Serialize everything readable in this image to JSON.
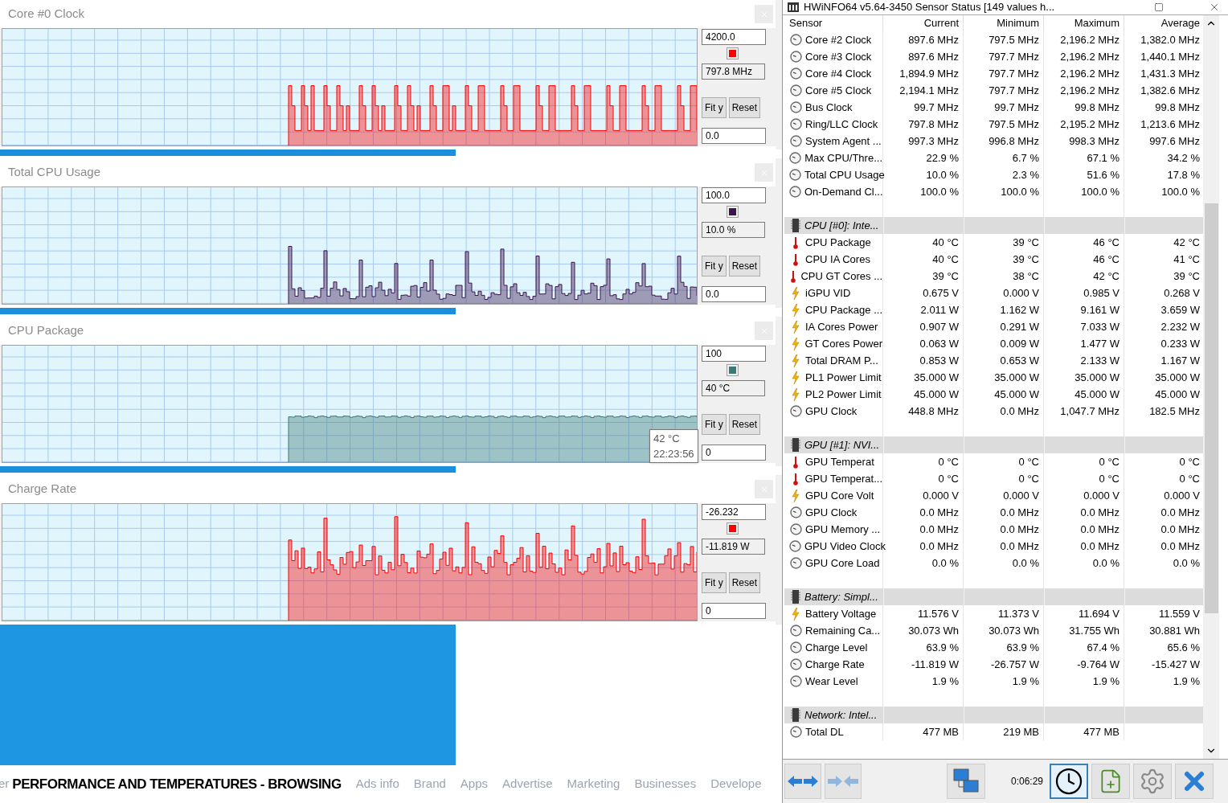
{
  "graphs": [
    {
      "title": "Core #0 Clock",
      "kind": "spiky",
      "color": "#ff0000",
      "max": "4200.0",
      "current": "797.8 MHz",
      "min": "0.0",
      "buttons": [
        "Fit y",
        "Reset"
      ]
    },
    {
      "title": "Total CPU Usage",
      "kind": "noisy",
      "color": "#3c1450",
      "max": "100.0",
      "current": "10.0 %",
      "min": "0.0",
      "buttons": [
        "Fit y",
        "Reset"
      ]
    },
    {
      "title": "CPU Package",
      "kind": "flat",
      "color": "#3c7878",
      "max": "100",
      "current": "40 °C",
      "min": "0",
      "buttons": [
        "Fit y",
        "Reset"
      ],
      "tooltip": {
        "value": "42 °C",
        "time": "22:23:56"
      }
    },
    {
      "title": "Charge Rate",
      "kind": "busy",
      "color": "#ff0000",
      "max": "-26.232",
      "current": "-11.819 W",
      "min": "0",
      "buttons": [
        "Fit y",
        "Reset"
      ]
    }
  ],
  "footer": {
    "edge_text": "er",
    "headline": "PERFORMANCE AND TEMPERATURES - BROWSING",
    "links": [
      "Ads info",
      "Brand",
      "Apps",
      "Advertise",
      "Marketing",
      "Businesses",
      "Develope"
    ]
  },
  "sensor_window": {
    "title": "HWiNFO64 v5.64-3450 Sensor Status [149 values h...",
    "columns": [
      "Sensor",
      "Current",
      "Minimum",
      "Maximum",
      "Average"
    ],
    "rows": [
      {
        "kind": "clock",
        "cells": [
          "Core #2 Clock",
          "897.6 MHz",
          "797.5 MHz",
          "2,196.2 MHz",
          "1,382.0 MHz"
        ]
      },
      {
        "kind": "clock",
        "cells": [
          "Core #3 Clock",
          "897.6 MHz",
          "797.7 MHz",
          "2,196.2 MHz",
          "1,440.1 MHz"
        ]
      },
      {
        "kind": "clock",
        "cells": [
          "Core #4 Clock",
          "1,894.9 MHz",
          "797.7 MHz",
          "2,196.2 MHz",
          "1,431.3 MHz"
        ]
      },
      {
        "kind": "clock",
        "cells": [
          "Core #5 Clock",
          "2,194.1 MHz",
          "797.7 MHz",
          "2,196.2 MHz",
          "1,382.6 MHz"
        ]
      },
      {
        "kind": "clock",
        "cells": [
          "Bus Clock",
          "99.7 MHz",
          "99.7 MHz",
          "99.8 MHz",
          "99.8 MHz"
        ]
      },
      {
        "kind": "clock",
        "cells": [
          "Ring/LLC Clock",
          "797.8 MHz",
          "797.5 MHz",
          "2,195.2 MHz",
          "1,213.6 MHz"
        ]
      },
      {
        "kind": "clock",
        "cells": [
          "System Agent ...",
          "997.3 MHz",
          "996.8 MHz",
          "998.3 MHz",
          "997.6 MHz"
        ]
      },
      {
        "kind": "clock",
        "cells": [
          "Max CPU/Thre...",
          "22.9 %",
          "6.7 %",
          "67.1 %",
          "34.2 %"
        ]
      },
      {
        "kind": "clock",
        "cells": [
          "Total CPU Usage",
          "10.0 %",
          "2.3 %",
          "51.6 %",
          "17.8 %"
        ]
      },
      {
        "kind": "clock",
        "cells": [
          "On-Demand Cl...",
          "100.0 %",
          "100.0 %",
          "100.0 %",
          "100.0 %"
        ]
      },
      {
        "kind": "blank"
      },
      {
        "kind": "group",
        "cells": [
          "CPU [#0]: Inte..."
        ]
      },
      {
        "kind": "temperature",
        "cells": [
          "CPU Package",
          "40 °C",
          "39 °C",
          "46 °C",
          "42 °C"
        ]
      },
      {
        "kind": "temperature",
        "cells": [
          "CPU IA Cores",
          "40 °C",
          "39 °C",
          "46 °C",
          "41 °C"
        ]
      },
      {
        "kind": "temperature",
        "cells": [
          "CPU GT Cores ...",
          "39 °C",
          "38 °C",
          "42 °C",
          "39 °C"
        ]
      },
      {
        "kind": "power",
        "cells": [
          "iGPU VID",
          "0.675 V",
          "0.000 V",
          "0.985 V",
          "0.268 V"
        ]
      },
      {
        "kind": "power",
        "cells": [
          "CPU Package ...",
          "2.011 W",
          "1.162 W",
          "9.161 W",
          "3.659 W"
        ]
      },
      {
        "kind": "power",
        "cells": [
          "IA Cores Power",
          "0.907 W",
          "0.291 W",
          "7.033 W",
          "2.232 W"
        ]
      },
      {
        "kind": "power",
        "cells": [
          "GT Cores Power",
          "0.063 W",
          "0.009 W",
          "1.477 W",
          "0.233 W"
        ]
      },
      {
        "kind": "power",
        "cells": [
          "Total DRAM P...",
          "0.853 W",
          "0.653 W",
          "2.133 W",
          "1.167 W"
        ]
      },
      {
        "kind": "power",
        "cells": [
          "PL1 Power Limit",
          "35.000 W",
          "35.000 W",
          "35.000 W",
          "35.000 W"
        ]
      },
      {
        "kind": "power",
        "cells": [
          "PL2 Power Limit",
          "45.000 W",
          "45.000 W",
          "45.000 W",
          "45.000 W"
        ]
      },
      {
        "kind": "clock",
        "cells": [
          "GPU Clock",
          "448.8 MHz",
          "0.0 MHz",
          "1,047.7 MHz",
          "182.5 MHz"
        ]
      },
      {
        "kind": "blank"
      },
      {
        "kind": "group",
        "cells": [
          "GPU [#1]: NVI..."
        ]
      },
      {
        "kind": "temperature",
        "cells": [
          "GPU Temperat",
          "0 °C",
          "0 °C",
          "0 °C",
          "0 °C"
        ]
      },
      {
        "kind": "temperature",
        "cells": [
          "GPU Temperat...",
          "0 °C",
          "0 °C",
          "0 °C",
          "0 °C"
        ]
      },
      {
        "kind": "power",
        "cells": [
          "GPU Core Volt",
          "0.000 V",
          "0.000 V",
          "0.000 V",
          "0.000 V"
        ]
      },
      {
        "kind": "clock",
        "cells": [
          "GPU Clock",
          "0.0 MHz",
          "0.0 MHz",
          "0.0 MHz",
          "0.0 MHz"
        ]
      },
      {
        "kind": "clock",
        "cells": [
          "GPU Memory ...",
          "0.0 MHz",
          "0.0 MHz",
          "0.0 MHz",
          "0.0 MHz"
        ]
      },
      {
        "kind": "clock",
        "cells": [
          "GPU Video Clock",
          "0.0 MHz",
          "0.0 MHz",
          "0.0 MHz",
          "0.0 MHz"
        ]
      },
      {
        "kind": "clock",
        "cells": [
          "GPU Core Load",
          "0.0 %",
          "0.0 %",
          "0.0 %",
          "0.0 %"
        ]
      },
      {
        "kind": "blank"
      },
      {
        "kind": "group",
        "cells": [
          "Battery: Simpl..."
        ]
      },
      {
        "kind": "power",
        "cells": [
          "Battery Voltage",
          "11.576 V",
          "11.373 V",
          "11.694 V",
          "11.559 V"
        ]
      },
      {
        "kind": "clock",
        "cells": [
          "Remaining Ca...",
          "30.073 Wh",
          "30.073 Wh",
          "31.755 Wh",
          "30.881 Wh"
        ]
      },
      {
        "kind": "clock",
        "cells": [
          "Charge Level",
          "63.9 %",
          "63.9 %",
          "67.4 %",
          "65.6 %"
        ]
      },
      {
        "kind": "clock",
        "cells": [
          "Charge Rate",
          "-11.819 W",
          "-26.757 W",
          "-9.764 W",
          "-15.427 W"
        ]
      },
      {
        "kind": "clock",
        "cells": [
          "Wear Level",
          "1.9 %",
          "1.9 %",
          "1.9 %",
          "1.9 %"
        ]
      },
      {
        "kind": "blank"
      },
      {
        "kind": "group",
        "cells": [
          "Network: Intel..."
        ]
      },
      {
        "kind": "clock",
        "cells": [
          "Total DL",
          "477 MB",
          "219 MB",
          "477 MB"
        ]
      }
    ],
    "timer": "0:06:29"
  }
}
